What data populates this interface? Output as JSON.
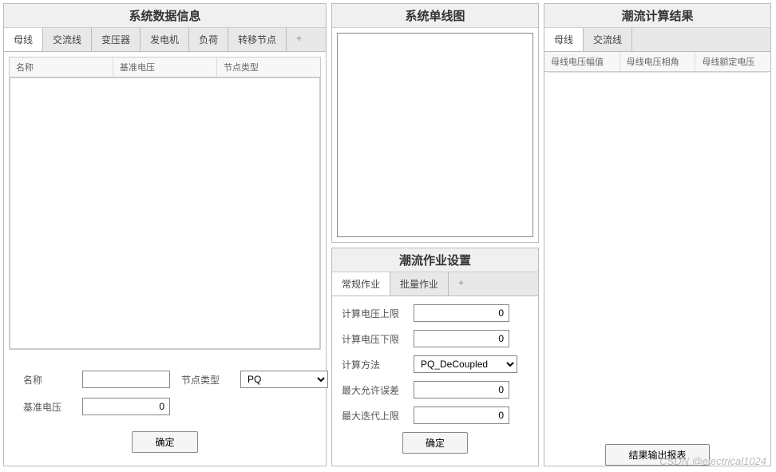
{
  "left": {
    "title": "系统数据信息",
    "tabs": [
      "母线",
      "交流线",
      "变压器",
      "发电机",
      "负荷",
      "转移节点"
    ],
    "add_tab": "+",
    "columns": [
      "名称",
      "基准电压",
      "节点类型"
    ],
    "form": {
      "name_label": "名称",
      "name_value": "",
      "type_label": "节点类型",
      "type_value": "PQ",
      "basev_label": "基准电压",
      "basev_value": "0",
      "submit": "确定"
    }
  },
  "diagram": {
    "title": "系统单线图"
  },
  "settings": {
    "title": "潮流作业设置",
    "tabs": [
      "常规作业",
      "批量作业"
    ],
    "add_tab": "+",
    "fields": {
      "vupper_label": "计算电压上限",
      "vupper_value": "0",
      "vlower_label": "计算电压下限",
      "vlower_value": "0",
      "method_label": "计算方法",
      "method_value": "PQ_DeCoupled",
      "tol_label": "最大允许误差",
      "tol_value": "0",
      "maxiter_label": "最大迭代上限",
      "maxiter_value": "0",
      "submit": "确定"
    }
  },
  "right": {
    "title": "潮流计算结果",
    "tabs": [
      "母线",
      "交流线"
    ],
    "columns": [
      "母线电压幅值",
      "母线电压相角",
      "母线额定电压"
    ],
    "export_btn": "结果输出报表"
  },
  "watermark": "CSDN @electrical1024"
}
